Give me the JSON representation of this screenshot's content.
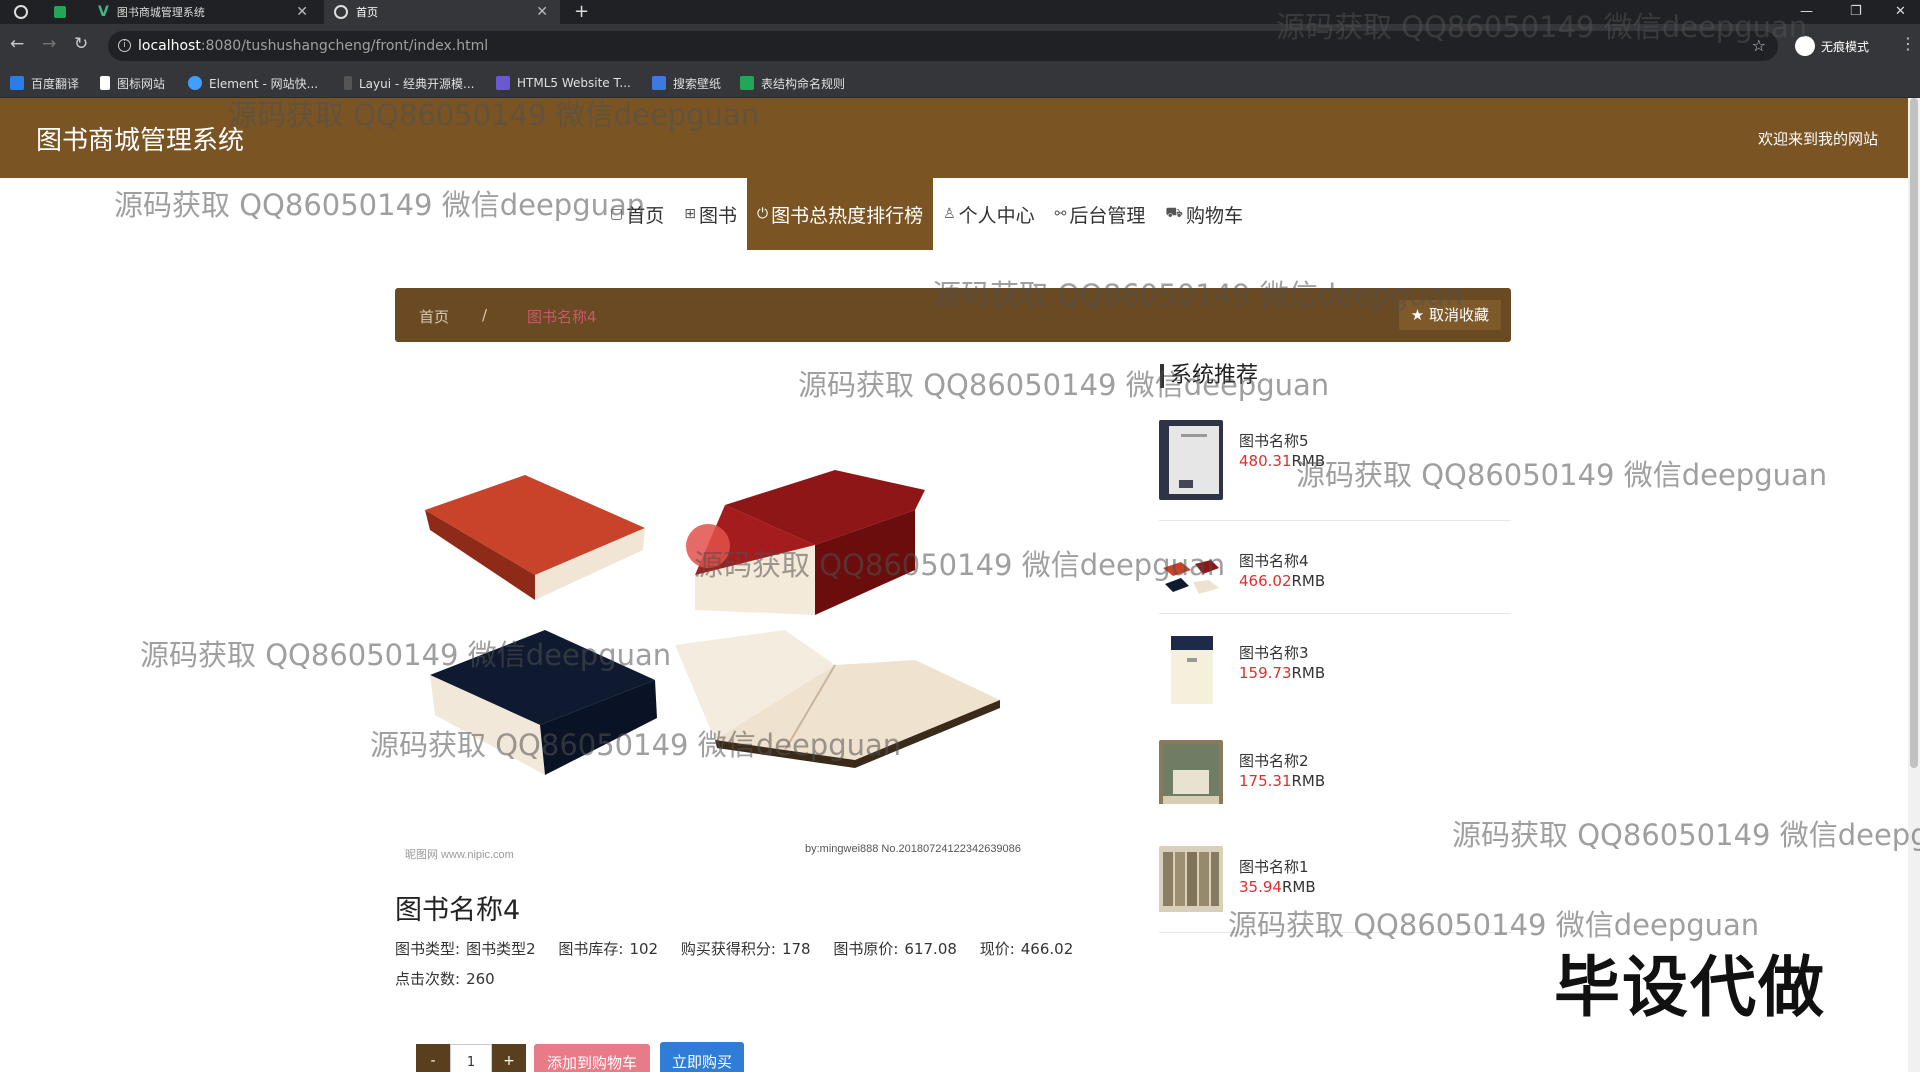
{
  "browser": {
    "tabs": [
      {
        "title": ""
      },
      {
        "title": ""
      },
      {
        "title": "图书商城管理系统"
      },
      {
        "title": "首页"
      }
    ],
    "url_host": "localhost",
    "url_path": ":8080/tushushangcheng/front/index.html",
    "incognito_label": "无痕模式",
    "bookmarks": [
      "百度翻译",
      "图标网站",
      "Element - 网站快...",
      "Layui - 经典开源模...",
      "HTML5 Website T...",
      "搜索壁纸",
      "表结构命名规则"
    ]
  },
  "header": {
    "site_title": "图书商城管理系统",
    "welcome": "欢迎来到我的网站"
  },
  "nav": {
    "items": [
      {
        "icon": "home-icon",
        "label": "首页",
        "active": false
      },
      {
        "icon": "grid-icon",
        "label": "图书",
        "active": false
      },
      {
        "icon": "power-icon",
        "label": "图书总热度排行榜",
        "active": true
      },
      {
        "icon": "user-icon",
        "label": "个人中心",
        "active": false
      },
      {
        "icon": "link-icon",
        "label": "后台管理",
        "active": false
      },
      {
        "icon": "cart-icon",
        "label": "购物车",
        "active": false
      }
    ]
  },
  "breadcrumb": {
    "home": "首页",
    "separator": "/",
    "current": "图书名称4",
    "favorite_button": "取消收藏"
  },
  "detail": {
    "title": "图书名称4",
    "fields": [
      {
        "label": "图书类型:",
        "value": "图书类型2"
      },
      {
        "label": "图书库存:",
        "value": "102"
      },
      {
        "label": "购买获得积分:",
        "value": "178"
      },
      {
        "label": "图书原价:",
        "value": "617.08"
      },
      {
        "label": "现价:",
        "value": "466.02"
      },
      {
        "label": "点击次数:",
        "value": "260"
      }
    ],
    "image_caption_left": "昵图网 www.nipic.com",
    "image_caption_right": "by:mingwei888 No.20180724122342639086",
    "quantity": "1",
    "minus_label": "-",
    "plus_label": "+",
    "add_to_cart": "添加到购物车",
    "buy_now": "立即购买"
  },
  "recommend": {
    "title": "系统推荐",
    "currency": "RMB",
    "items": [
      {
        "name": "图书名称5",
        "price": "480.31"
      },
      {
        "name": "图书名称4",
        "price": "466.02"
      },
      {
        "name": "图书名称3",
        "price": "159.73"
      },
      {
        "name": "图书名称2",
        "price": "175.31"
      },
      {
        "name": "图书名称1",
        "price": "35.94"
      }
    ]
  },
  "watermark": "源码获取 QQ86050149 微信deepguan",
  "badge": "毕设代做",
  "colors": {
    "brown": "#7a5423",
    "price_red": "#d9302f",
    "buy_blue": "#2f7dd6",
    "cart_pink": "#e97a88"
  }
}
